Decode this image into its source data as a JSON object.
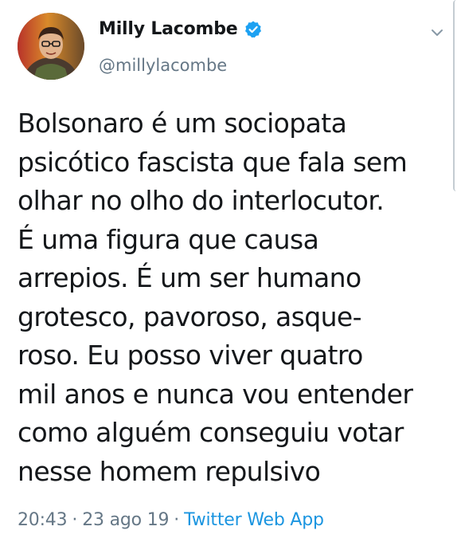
{
  "author": {
    "display_name": "Milly Lacombe",
    "handle": "@millylacombe",
    "verified": true
  },
  "icons": {
    "avatar": "profile-photo",
    "verified": "verified-badge-icon",
    "menu": "chevron-down-icon"
  },
  "tweet": {
    "lines": [
      "Bolsonaro é um sociopata",
      "psicótico fascista que fala sem",
      "olhar no olho do interlocutor.",
      "É uma figura que causa",
      "arrepios. É um ser humano",
      "grotesco, pavoroso, asque-",
      "roso. Eu posso viver quatro",
      "mil anos e nunca vou entender",
      "como alguém conseguiu votar",
      "nesse homem repulsivo"
    ]
  },
  "meta": {
    "time": "20:43",
    "separator": "·",
    "date": "23 ago 19",
    "source": "Twitter Web App"
  },
  "colors": {
    "text": "#14171a",
    "secondary": "#657786",
    "link": "#1b95e0",
    "verified": "#1da1f2"
  }
}
